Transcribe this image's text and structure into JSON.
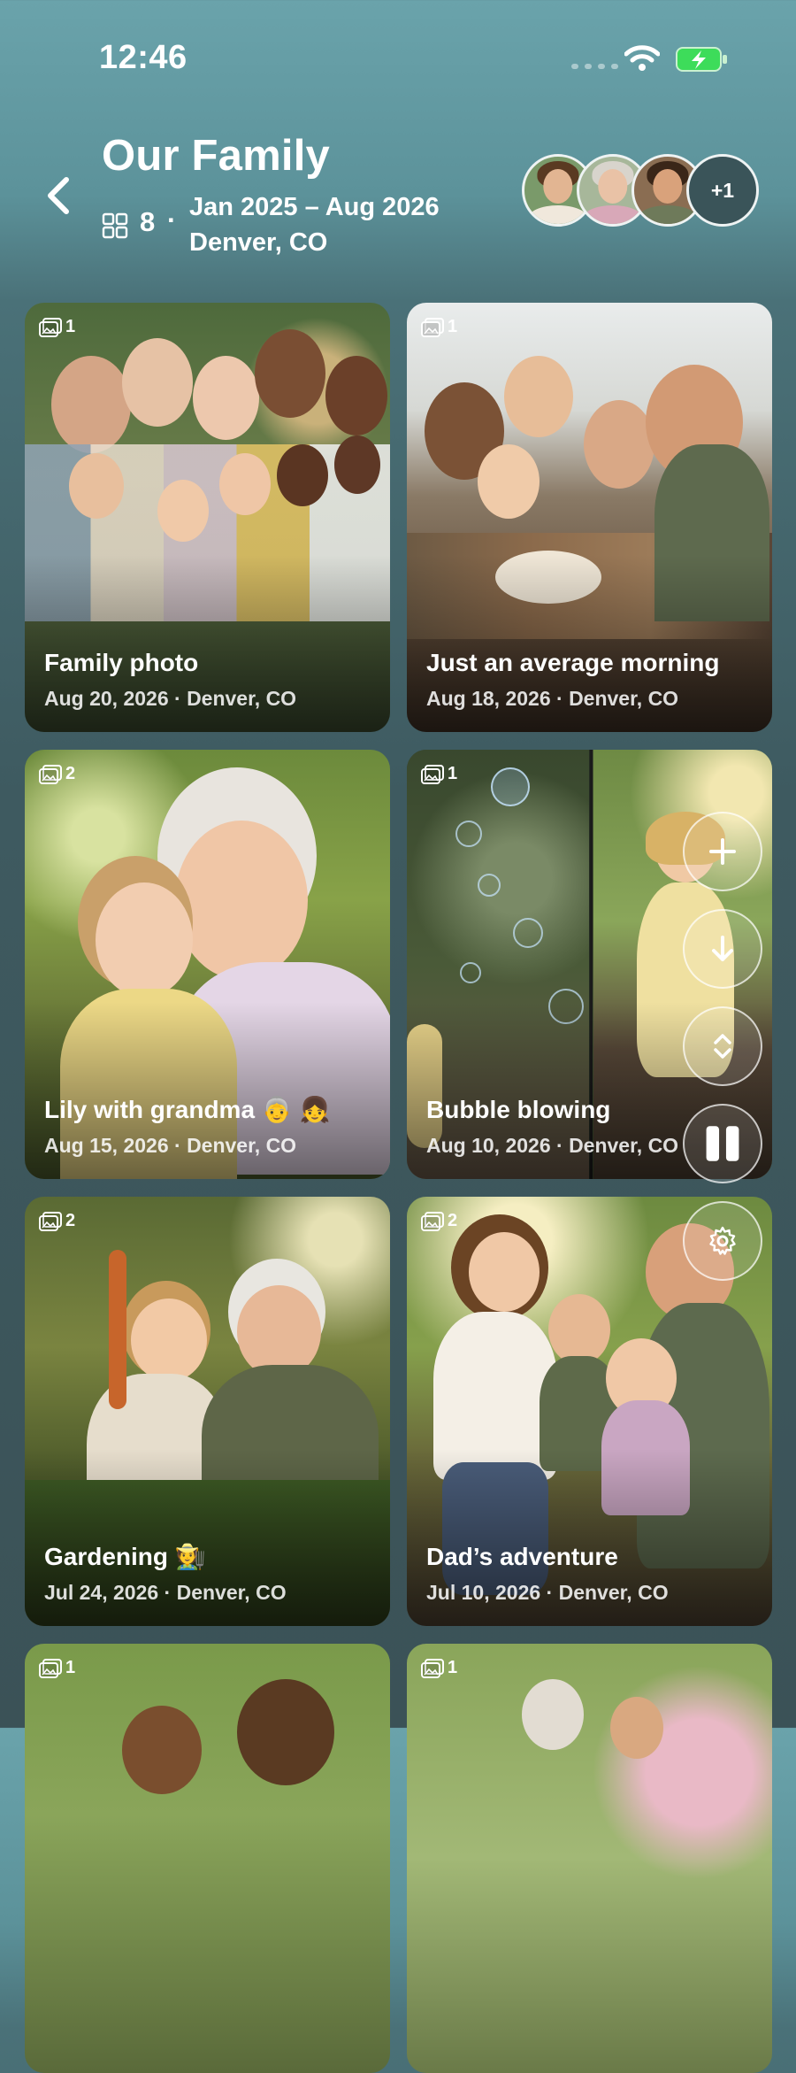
{
  "status_bar": {
    "time": "12:46"
  },
  "header": {
    "title": "Our Family",
    "photo_count": "8",
    "separator": "·",
    "date_range": "Jan 2025 – Aug 2026",
    "location": "Denver, CO",
    "more_members": "+1"
  },
  "cards": [
    {
      "count": "1",
      "title": "Family photo",
      "subtitle": "Aug 20, 2026 · Denver, CO"
    },
    {
      "count": "1",
      "title": "Just an average morning",
      "subtitle": "Aug 18, 2026 · Denver, CO"
    },
    {
      "count": "2",
      "title": "Lily with grandma 👵 👧",
      "subtitle": "Aug 15, 2026 · Denver, CO"
    },
    {
      "count": "1",
      "title": "Bubble blowing",
      "subtitle": "Aug 10, 2026 · Denver, CO"
    },
    {
      "count": "2",
      "title": "Gardening 🧑‍🌾",
      "subtitle": "Jul 24, 2026 · Denver, CO"
    },
    {
      "count": "2",
      "title": "Dad’s adventure",
      "subtitle": "Jul 10, 2026 · Denver, CO"
    },
    {
      "count": "1",
      "title": "",
      "subtitle": ""
    },
    {
      "count": "1",
      "title": "",
      "subtitle": ""
    }
  ],
  "icons": {
    "back": "chevron-left-icon",
    "grid": "grid-icon",
    "photos": "photo-stack-icon",
    "add": "plus-icon",
    "download": "arrow-down-icon",
    "expand": "chevron-up-down-icon",
    "pause": "pause-icon",
    "settings": "gear-icon"
  },
  "colors": {
    "battery": "#3ddc5a",
    "background_top": "#6aa3ab",
    "background_bottom": "#3b5257"
  }
}
